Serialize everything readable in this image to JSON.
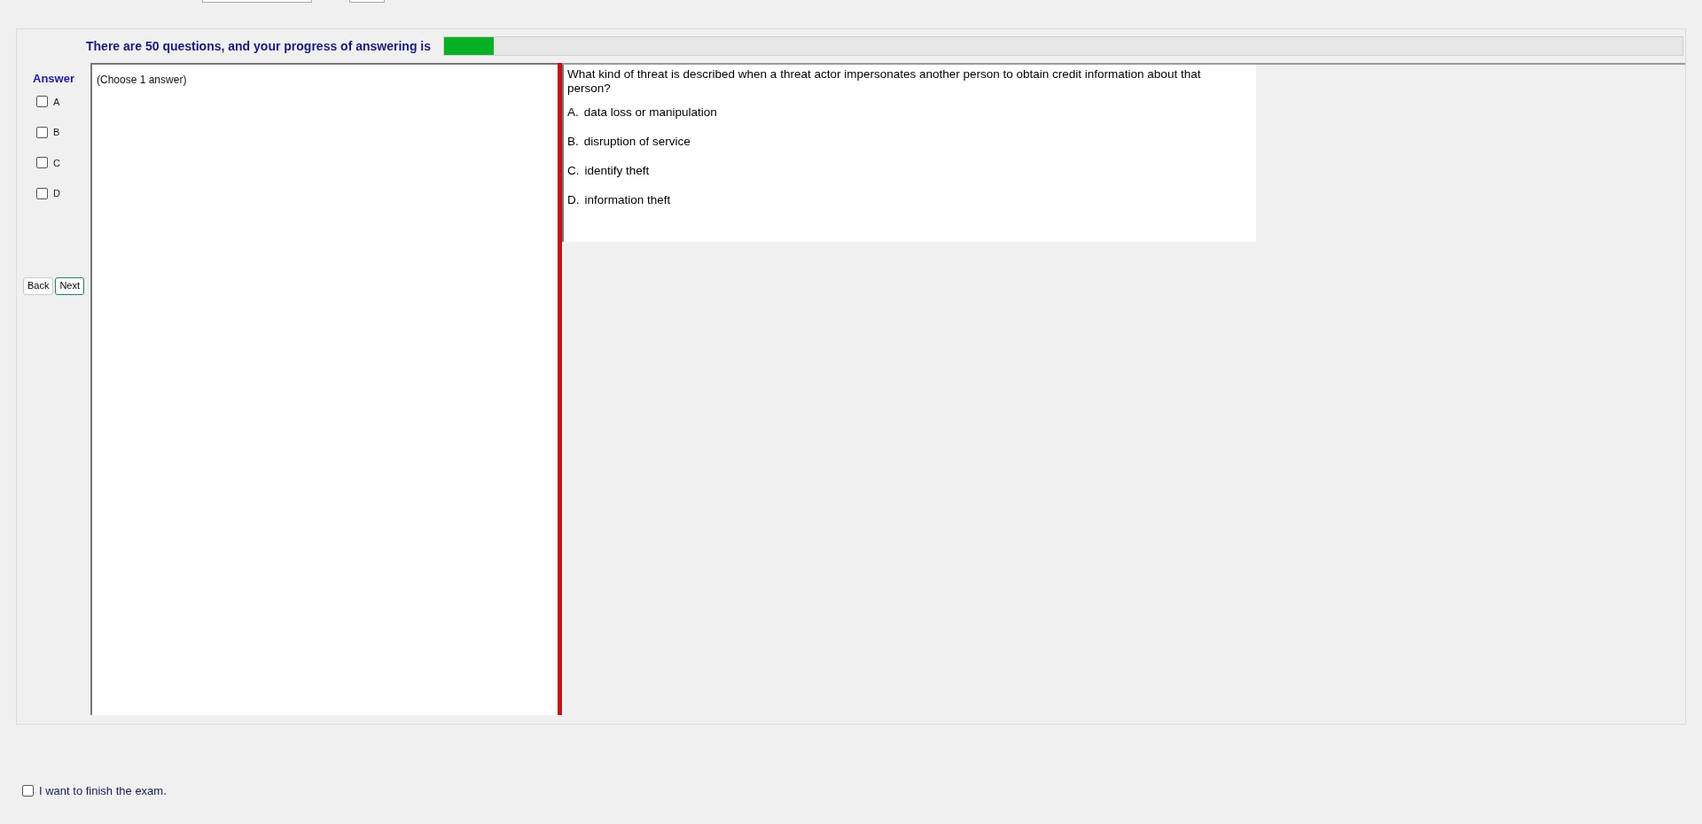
{
  "progress": {
    "label": "There are 50 questions, and your progress of answering is",
    "level": 0.04
  },
  "answer": {
    "title": "Answer",
    "options": [
      {
        "label": "A",
        "checked": false
      },
      {
        "label": "B",
        "checked": false
      },
      {
        "label": "C",
        "checked": false
      },
      {
        "label": "D",
        "checked": false
      }
    ]
  },
  "buttons": [
    {
      "label": "Back",
      "selected": false
    },
    {
      "label": "Next",
      "selected": true
    }
  ],
  "instruction": "(Choose 1 answer)",
  "question": {
    "text": "What kind of threat is described when a threat actor impersonates another person to obtain credit information about that person?",
    "choices": [
      {
        "letter": "A.",
        "text": "data loss or manipulation"
      },
      {
        "letter": "B.",
        "text": "disruption of service"
      },
      {
        "letter": "C.",
        "text": "identify theft"
      },
      {
        "letter": "D.",
        "text": "information theft"
      }
    ]
  },
  "finish": {
    "label": "I want to finish the exam.",
    "checked": false
  }
}
